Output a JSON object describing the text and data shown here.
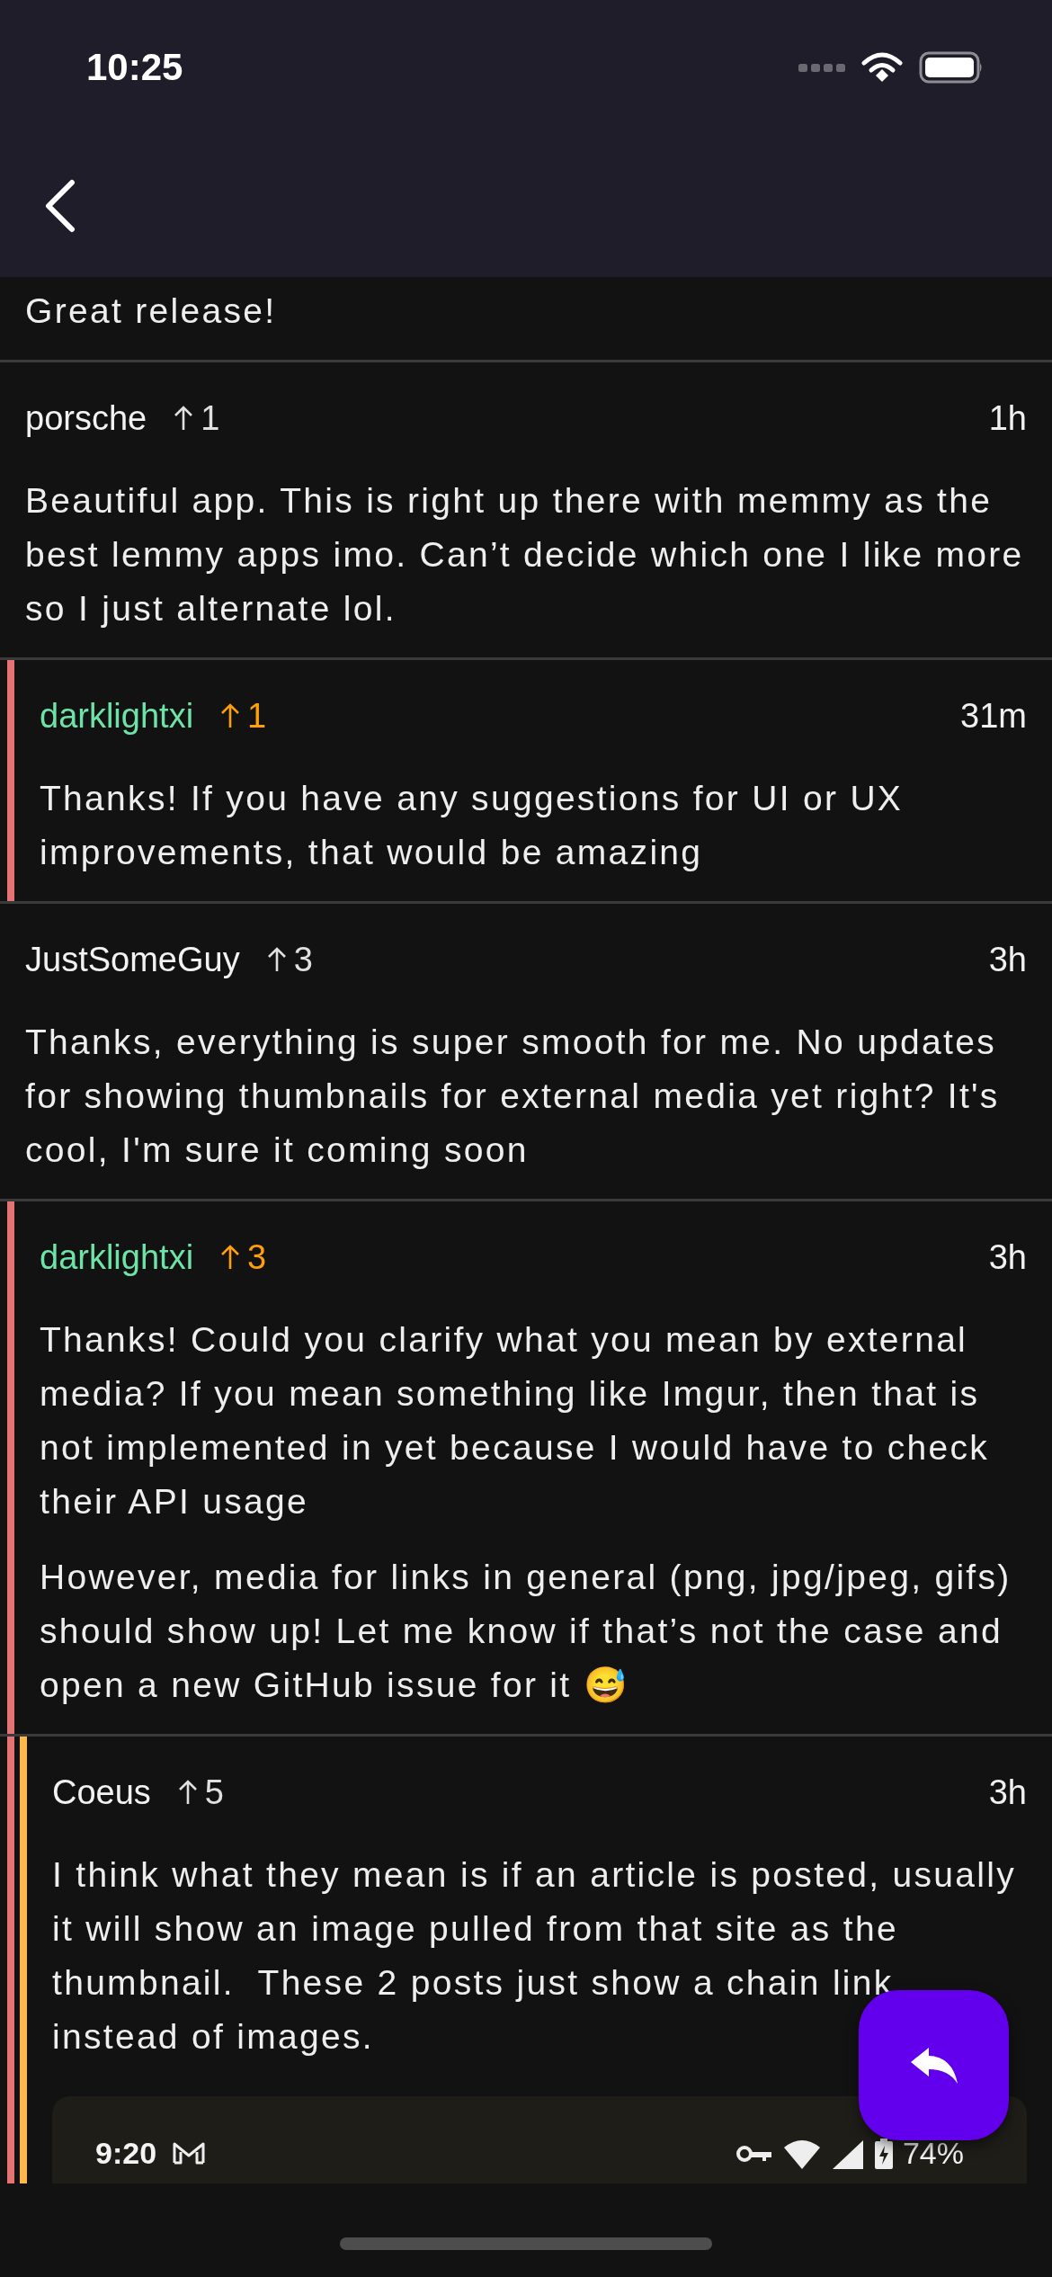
{
  "status_bar": {
    "time": "10:25"
  },
  "comments": [
    {
      "body": [
        "Great release!"
      ]
    },
    {
      "author": "porsche",
      "is_op": false,
      "upvoted": false,
      "score": "1",
      "time": "1h",
      "body": [
        "Beautiful app. This is right up there with memmy as the best lemmy apps imo. Can’t decide which one I like more so I just alternate lol."
      ],
      "children": [
        {
          "author": "darklightxi",
          "is_op": true,
          "upvoted": true,
          "score": "1",
          "time": "31m",
          "body": [
            "Thanks! If you have any suggestions for UI or UX improvements, that would be amazing"
          ]
        }
      ]
    },
    {
      "author": "JustSomeGuy",
      "is_op": false,
      "upvoted": false,
      "score": "3",
      "time": "3h",
      "body": [
        "Thanks, everything is super smooth for me. No updates for showing thumbnails for external media yet right? It's cool, I'm sure it coming soon"
      ],
      "children": [
        {
          "author": "darklightxi",
          "is_op": true,
          "upvoted": true,
          "score": "3",
          "time": "3h",
          "body": [
            "Thanks! Could you clarify what you mean by external media? If you mean something like Imgur, then that is not implemented in yet because I would have to check their API usage",
            "However, media for links in general (png, jpg/jpeg, gifs) should show up! Let me know if that’s not the case and open a new GitHub issue for it 😅"
          ],
          "children": [
            {
              "author": "Coeus",
              "is_op": false,
              "upvoted": false,
              "score": "5",
              "time": "3h",
              "body": [
                "I think what they mean is if an article is posted, usually it will show an image pulled from that site as the thumbnail.  These 2 posts just show a chain link instead of images."
              ],
              "image": {
                "kind": "screenshot",
                "time": "9:20",
                "battery": "74%"
              }
            }
          ]
        }
      ]
    }
  ]
}
